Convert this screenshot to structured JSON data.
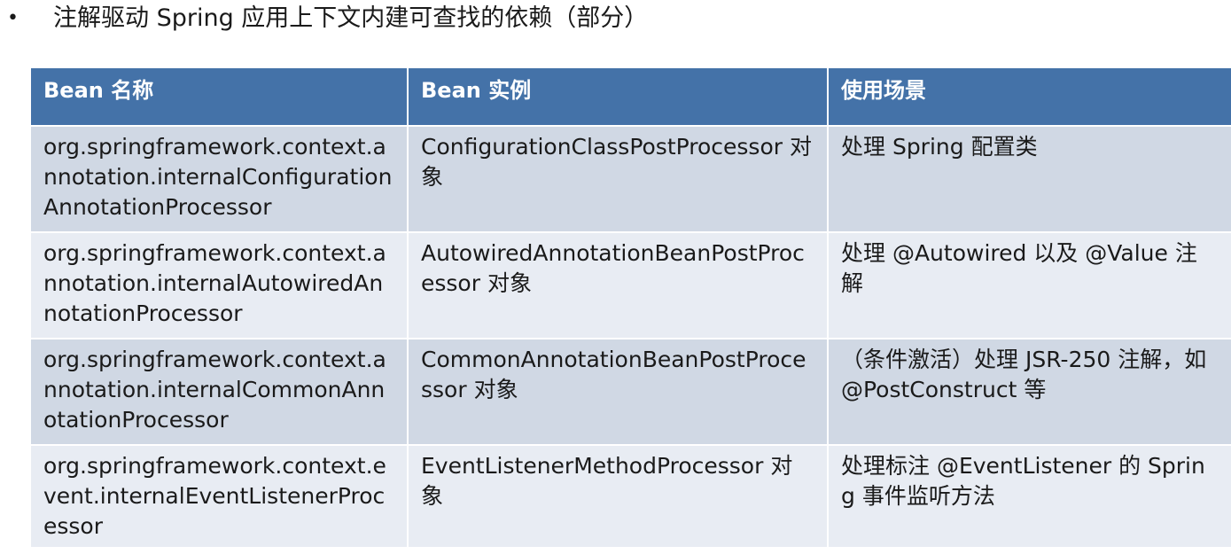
{
  "heading": {
    "bullet": "•",
    "text": "注解驱动 Spring 应用上下文内建可查找的依赖（部分）"
  },
  "table": {
    "headers": [
      "Bean 名称",
      "Bean 实例",
      "使用场景"
    ],
    "rows": [
      {
        "name": "org.springframework.context.annotation.internalConfigurationAnnotationProcessor",
        "instance": "ConfigurationClassPostProcessor 对象",
        "usage": "处理 Spring 配置类"
      },
      {
        "name": "org.springframework.context.annotation.internalAutowiredAnnotationProcessor",
        "instance": "AutowiredAnnotationBeanPostProcessor 对象",
        "usage": "处理 @Autowired 以及 @Value 注解"
      },
      {
        "name": "org.springframework.context.annotation.internalCommonAnnotationProcessor",
        "instance": "CommonAnnotationBeanPostProcessor 对象",
        "usage": "（条件激活）处理 JSR-250 注解，如 @PostConstruct 等"
      },
      {
        "name": "org.springframework.context.event.internalEventListenerProcessor",
        "instance": "EventListenerMethodProcessor 对象",
        "usage": "处理标注 @EventListener 的 Spring 事件监听方法"
      }
    ]
  },
  "colors": {
    "header_bg": "#4472a8",
    "row_odd_bg": "#d0d8e4",
    "row_even_bg": "#e8ecf3",
    "header_text": "#ffffff"
  }
}
